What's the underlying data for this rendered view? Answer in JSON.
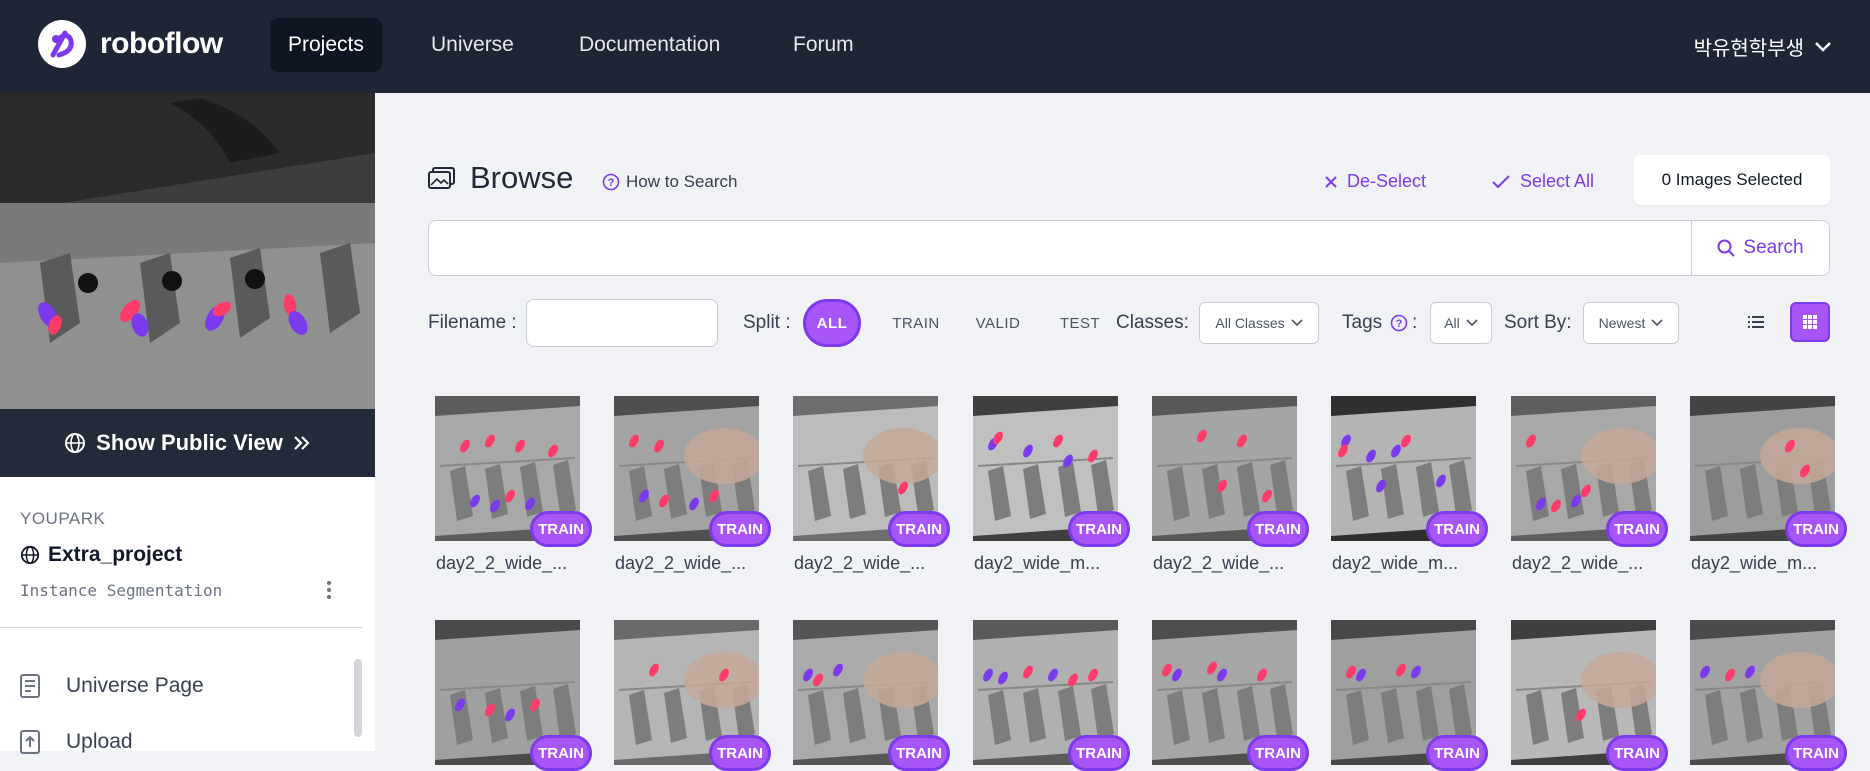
{
  "topnav": {
    "brand": "roboflow",
    "items": [
      {
        "label": "Projects",
        "active": true
      },
      {
        "label": "Universe",
        "active": false
      },
      {
        "label": "Documentation",
        "active": false
      },
      {
        "label": "Forum",
        "active": false
      }
    ],
    "user": "박유현학부생"
  },
  "sidebar": {
    "public_view_label": "Show Public View",
    "workspace": "YOUPARK",
    "project_name": "Extra_project",
    "project_type": "Instance Segmentation",
    "items": [
      {
        "label": "Universe Page",
        "icon": "page-icon"
      },
      {
        "label": "Upload",
        "icon": "upload-icon"
      }
    ]
  },
  "browse": {
    "title": "Browse",
    "how_to_search": "How to Search",
    "deselect": "De-Select",
    "select_all": "Select All",
    "selected_count": "0 Images Selected",
    "search_value": "",
    "search_button": "Search"
  },
  "filters": {
    "filename_label": "Filename :",
    "filename_value": "",
    "split_label": "Split :",
    "split_options": [
      "ALL",
      "TRAIN",
      "VALID",
      "TEST"
    ],
    "split_selected": "ALL",
    "classes_label": "Classes:",
    "classes_value": "All Classes",
    "tags_label": "Tags",
    "tags_colon": ":",
    "tags_value": "All",
    "sort_label": "Sort By:",
    "sort_value": "Newest",
    "view_mode": "grid"
  },
  "images": [
    {
      "name": "day2_2_wide_...",
      "split": "TRAIN"
    },
    {
      "name": "day2_2_wide_...",
      "split": "TRAIN"
    },
    {
      "name": "day2_2_wide_...",
      "split": "TRAIN"
    },
    {
      "name": "day2_wide_m...",
      "split": "TRAIN"
    },
    {
      "name": "day2_2_wide_...",
      "split": "TRAIN"
    },
    {
      "name": "day2_wide_m...",
      "split": "TRAIN"
    },
    {
      "name": "day2_2_wide_...",
      "split": "TRAIN"
    },
    {
      "name": "day2_wide_m...",
      "split": "TRAIN"
    },
    {
      "name": "",
      "split": "TRAIN"
    },
    {
      "name": "",
      "split": "TRAIN"
    },
    {
      "name": "",
      "split": "TRAIN"
    },
    {
      "name": "",
      "split": "TRAIN"
    },
    {
      "name": "",
      "split": "TRAIN"
    },
    {
      "name": "",
      "split": "TRAIN"
    },
    {
      "name": "",
      "split": "TRAIN"
    },
    {
      "name": "",
      "split": "TRAIN"
    }
  ],
  "colors": {
    "nav_bg": "#1e2636",
    "accent": "#7c3aed",
    "badge": "#a855f7"
  }
}
